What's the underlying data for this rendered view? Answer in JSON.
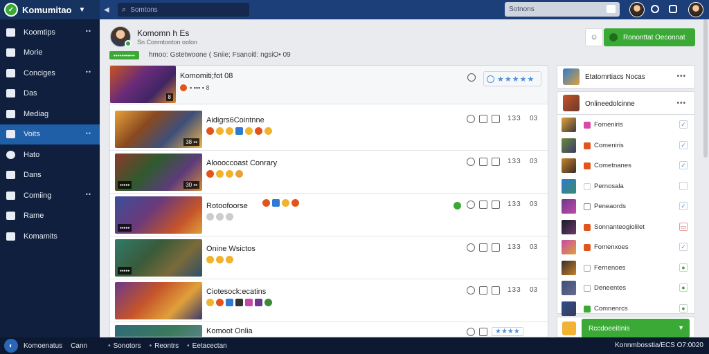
{
  "topbar": {
    "app_name": "Komumitao",
    "search_placeholder": "Somtons",
    "right_search_placeholder": "Sotnons"
  },
  "sidebar": {
    "items": [
      {
        "label": "Koomtips",
        "icon": "home-icon"
      },
      {
        "label": "Morie",
        "icon": "camera-icon"
      },
      {
        "label": "Conciges",
        "icon": "book-icon"
      },
      {
        "label": "Das",
        "icon": "bag-icon"
      },
      {
        "label": "Mediag",
        "icon": "monitor-icon"
      },
      {
        "label": "Voits",
        "icon": "folder-icon",
        "active": true
      },
      {
        "label": "Hato",
        "icon": "search-icon"
      },
      {
        "label": "Dans",
        "icon": "briefcase-icon"
      },
      {
        "label": "Comiing",
        "icon": "list-icon"
      },
      {
        "label": "Rame",
        "icon": "pin-icon"
      },
      {
        "label": "Komamits",
        "icon": "share-icon"
      }
    ]
  },
  "profile": {
    "name": "Komomn h Es",
    "subtitle": "Sn Conmtonton oolon",
    "online_badge": "•••••••••••",
    "stats": "hmoo: Gstetwoone ( Sniie;  Fsanoitl:  ngsiO•  09",
    "small_button_icon": "smile-icon",
    "primary_button": "Rononttat Oeconnat"
  },
  "featured": {
    "title": "Komomiti;fot 08",
    "meta": "▪ ▪▪▪ ▪ 8",
    "thumb_label": "8",
    "rating_stars": "★★★★★"
  },
  "rows": [
    {
      "title": "Aidigrs6Cointnne",
      "thumb_label": "38 ▪▪",
      "count": "133",
      "more": "03"
    },
    {
      "title": "Aloooccoast Conrary",
      "thumb_label": "30 ▪▪",
      "thumb_label_left": "▪▪▪▪▪",
      "count": "133",
      "more": "03"
    },
    {
      "title": "Rotoofoorse",
      "thumb_label_left": "▪▪▪▪▪",
      "count": "133",
      "more": "03"
    },
    {
      "title": "Onine Wsictos",
      "thumb_label_left": "▪▪▪▪▪",
      "count": "133",
      "more": "03"
    },
    {
      "title": "Ciotesock:ecatins",
      "count": "133",
      "more": "03"
    },
    {
      "title": "Komoot Onlia",
      "stars": "★★★★",
      "count": "133",
      "more": "03"
    }
  ],
  "right_panel": {
    "card1_title": "Etatomrtiacs Nocas",
    "card2_title": "Onlineedolcinne",
    "items": [
      {
        "label": "Fomeniris",
        "checked": true,
        "color": "#4f8fd6",
        "mark": "#d94aa8"
      },
      {
        "label": "Comeniris",
        "checked": true,
        "color": "#4f8fd6",
        "mark": "#e2541b"
      },
      {
        "label": "Cometnanes",
        "checked": true,
        "color": "#4f8fd6",
        "mark": "#e2541b"
      },
      {
        "label": "Pernosala",
        "checked": false,
        "color": "#4f8fd6",
        "mark": "#cccccc"
      },
      {
        "label": "Peneaords",
        "checked": true,
        "color": "#4f8fd6",
        "mark": "#888888"
      },
      {
        "label": "Sonnanteogiolilet",
        "checked": false,
        "color": "#e06666",
        "mark": "#e2541b"
      },
      {
        "label": "Fomenxoes",
        "checked": true,
        "color": "#4f8fd6",
        "mark": "#e2541b"
      },
      {
        "label": "Fernenoes",
        "checked": true,
        "color": "#3aa935",
        "mark": "#aaaaaa"
      },
      {
        "label": "Deneentes",
        "checked": true,
        "color": "#3aa935",
        "mark": "#aaaaaa"
      },
      {
        "label": "Comnenrcs",
        "checked": true,
        "color": "#3aa935",
        "mark": "#3aa935"
      }
    ],
    "bottom_button": "Rccdoeeitinis"
  },
  "bottombar": {
    "left_text": "Komoenatus",
    "left_text2": "Cann",
    "links": [
      "Sonotors",
      "Reontrs",
      "Eetacectan"
    ],
    "right_text": "Konnmbosstia/ECS  O7:0020"
  }
}
